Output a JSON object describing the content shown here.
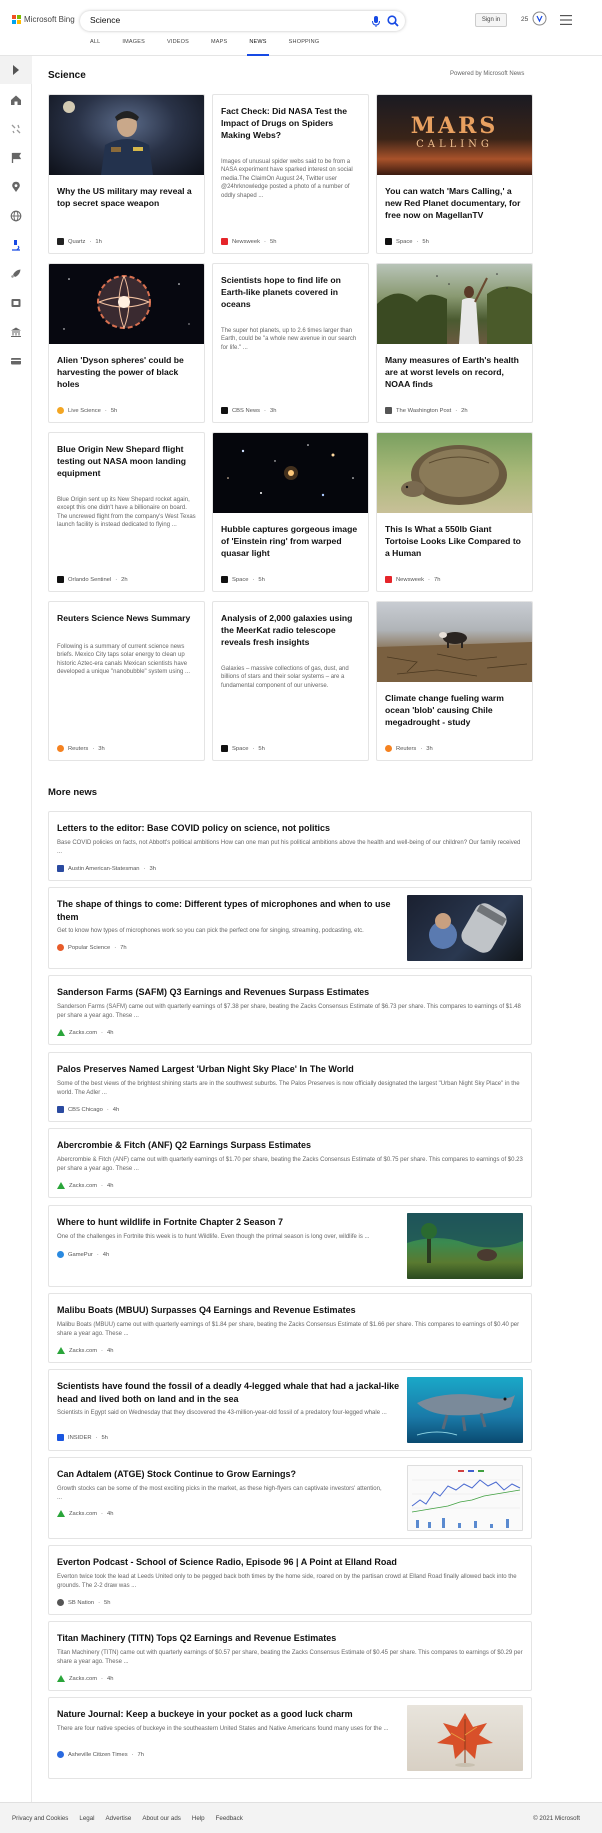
{
  "header": {
    "logo_text": "Microsoft Bing",
    "query": "Science",
    "signin_label": "Sign in",
    "rewards_points": "25",
    "tabs": [
      "ALL",
      "IMAGES",
      "VIDEOS",
      "MAPS",
      "NEWS",
      "SHOPPING"
    ],
    "active_tab": "NEWS"
  },
  "section": {
    "title": "Science",
    "powered_by": "Powered by Microsoft News"
  },
  "cards": [
    {
      "title": "Why the US military may reveal a top secret space weapon",
      "source": "Quartz",
      "age": "1h",
      "image": "military-general-photo",
      "source_color": "#222222"
    },
    {
      "title": "Fact Check: Did NASA Test the Impact of Drugs on Spiders Making Webs?",
      "description": "Images of unusual spider webs said to be from a NASA experiment have sparked interest on social media.The ClaimOn August 24, Twitter user @24hrknowledge posted a photo of a number of oddly shaped ...",
      "source": "Newsweek",
      "age": "5h",
      "source_color": "#e5252a"
    },
    {
      "title": "You can watch 'Mars Calling,' a new Red Planet documentary, for free now on MagellanTV",
      "source": "Space",
      "age": "5h",
      "image": "mars-calling-poster",
      "image_text": "MARS",
      "image_subtext": "CALLING",
      "source_color": "#111111"
    },
    {
      "title": "Alien 'Dyson spheres' could be harvesting the power of black holes",
      "source": "Live Science",
      "age": "5h",
      "image": "dyson-sphere-render",
      "source_color": "#f3a623"
    },
    {
      "title": "Scientists hope to find life on Earth-like planets covered in oceans",
      "description": "The super hot planets, up to 2.6 times larger than Earth, could be \"a whole new avenue in our search for life.\" ...",
      "source": "CBS News",
      "age": "3h",
      "source_color": "#111111"
    },
    {
      "title": "Many measures of Earth's health are at worst levels on record, NOAA finds",
      "source": "The Washington Post",
      "age": "2h",
      "image": "man-with-locusts-photo",
      "source_color": "#555555"
    },
    {
      "title": "Blue Origin New Shepard flight testing out NASA moon landing equipment",
      "description": "Blue Origin sent up its New Shepard rocket again, except this one didn't have a billionaire on board. The uncrewed flight from the company's West Texas launch facility is instead dedicated to flying ...",
      "source": "Orlando Sentinel",
      "age": "2h",
      "source_color": "#111111"
    },
    {
      "title": "Hubble captures gorgeous image of 'Einstein ring' from warped quasar light",
      "source": "Space",
      "age": "5h",
      "image": "hubble-deep-field",
      "source_color": "#111111"
    },
    {
      "title": "This Is What a 550lb Giant Tortoise Looks Like Compared to a Human",
      "source": "Newsweek",
      "age": "7h",
      "image": "giant-tortoise-photo",
      "source_color": "#e5252a"
    },
    {
      "title": "Reuters Science News Summary",
      "description": "Following is a summary of current science news briefs. Mexico City taps solar energy to clean up historic Aztec-era canals Mexican scientists have developed a unique \"nanobubble\" system using ...",
      "source": "Reuters",
      "age": "3h",
      "source_color": "#f58220"
    },
    {
      "title": "Analysis of 2,000 galaxies using the MeerKat radio telescope reveals fresh insights",
      "description": "Galaxies – massive collections of gas, dust, and billions of stars and their solar systems – are a fundamental component of our universe.",
      "source": "Space",
      "age": "5h",
      "source_color": "#111111"
    },
    {
      "title": "Climate change fueling warm ocean 'blob' causing Chile megadrought - study",
      "source": "Reuters",
      "age": "3h",
      "image": "drought-cattle-photo",
      "source_color": "#f58220"
    }
  ],
  "more_news": {
    "title": "More news",
    "items": [
      {
        "title": "Letters to the editor: Base COVID policy on science, not politics",
        "description": "Base COVID policies on facts, not Abbott's political ambitions How can one man put his political ambitions above the health and well-being of our children? Our family received ...",
        "source": "Austin American-Statesman",
        "age": "3h",
        "source_color": "#2a4aa0"
      },
      {
        "title": "The shape of things to come: Different types of microphones and when to use them",
        "description": "Get to know how types of microphones work so you can pick the perfect one for singing, streaming, podcasting, etc.",
        "source": "Popular Science",
        "age": "7h",
        "thumb": "microphone-photo",
        "source_color": "#e85c2a"
      },
      {
        "title": "Sanderson Farms (SAFM) Q3 Earnings and Revenues Surpass Estimates",
        "description": "Sanderson Farms (SAFM) came out with quarterly earnings of $7.38 per share, beating the Zacks Consensus Estimate of $6.73 per share. This compares to earnings of $1.48 per share a year ago. These ...",
        "source": "Zacks.com",
        "age": "4h",
        "source_color": "#2aa53a"
      },
      {
        "title": "Palos Preserves Named Largest 'Urban Night Sky Place' In The World",
        "description": "Some of the best views of the brightest shining starts are in the southwest suburbs. The Palos Preserves is now officially designated the largest \"Urban Night Sky Place\" in the world. The Adler ...",
        "source": "CBS Chicago",
        "age": "4h",
        "source_color": "#2a4aa0"
      },
      {
        "title": "Abercrombie & Fitch (ANF) Q2 Earnings Surpass Estimates",
        "description": "Abercrombie & Fitch (ANF) came out with quarterly earnings of $1.70 per share, beating the Zacks Consensus Estimate of $0.75 per share. This compares to earnings of $0.23 per share a year ago. These ...",
        "source": "Zacks.com",
        "age": "4h",
        "source_color": "#2aa53a"
      },
      {
        "title": "Where to hunt wildlife in Fortnite Chapter 2 Season 7",
        "description": "One of the challenges in Fortnite this week is to hunt Wildlife. Even though the primal season is long over, wildlife is ...",
        "source": "GamePur",
        "age": "4h",
        "thumb": "fortnite-screenshot",
        "source_color": "#2a8ae0"
      },
      {
        "title": "Malibu Boats (MBUU) Surpasses Q4 Earnings and Revenue Estimates",
        "description": "Malibu Boats (MBUU) came out with quarterly earnings of $1.84 per share, beating the Zacks Consensus Estimate of $1.66 per share. This compares to earnings of $0.40 per share a year ago. These ...",
        "source": "Zacks.com",
        "age": "4h",
        "source_color": "#2aa53a"
      },
      {
        "title": "Scientists have found the fossil of a deadly 4-legged whale that had a jackal-like head and lived both on land and in the sea",
        "description": "Scientists in Egypt said on Wednesday that they discovered the 43-million-year-old fossil of a predatory four-legged whale ...",
        "source": "INSIDER",
        "age": "5h",
        "thumb": "ancient-whale-illustration",
        "source_color": "#1a56e0"
      },
      {
        "title": "Can Adtalem (ATGE) Stock Continue to Grow Earnings?",
        "description": "Growth stocks can be some of the most exciting picks in the market, as these high-flyers can captivate investors' attention, ...",
        "source": "Zacks.com",
        "age": "4h",
        "thumb": "stock-chart-image",
        "source_color": "#2aa53a"
      },
      {
        "title": "Everton Podcast - School of Science Radio, Episode 96 | A Point at Elland Road",
        "description": "Everton twice took the lead at Leeds United only to be pegged back both times by the home side, roared on by the partisan crowd at Elland Road finally allowed back into the grounds. The 2-2 draw was ...",
        "source": "SB Nation",
        "age": "5h",
        "source_color": "#555555"
      },
      {
        "title": "Titan Machinery (TITN) Tops Q2 Earnings and Revenue Estimates",
        "description": "Titan Machinery (TITN) came out with quarterly earnings of $0.57 per share, beating the Zacks Consensus Estimate of $0.45 per share. This compares to earnings of $0.29 per share a year ago. These ...",
        "source": "Zacks.com",
        "age": "4h",
        "source_color": "#2aa53a"
      },
      {
        "title": "Nature Journal: Keep a buckeye in your pocket as a good luck charm",
        "description": "There are four native species of buckeye in the southeastern United States and Native Americans found many uses for the ...",
        "source": "Asheville Citizen Times",
        "age": "7h",
        "thumb": "autumn-leaf-photo",
        "source_color": "#2a6ae0"
      }
    ]
  },
  "footer": {
    "links": [
      "Privacy and Cookies",
      "Legal",
      "Advertise",
      "About our ads",
      "Help",
      "Feedback"
    ],
    "copyright": "© 2021 Microsoft"
  },
  "colors": {
    "accent": "#174ae4",
    "background": "#ffffff"
  }
}
